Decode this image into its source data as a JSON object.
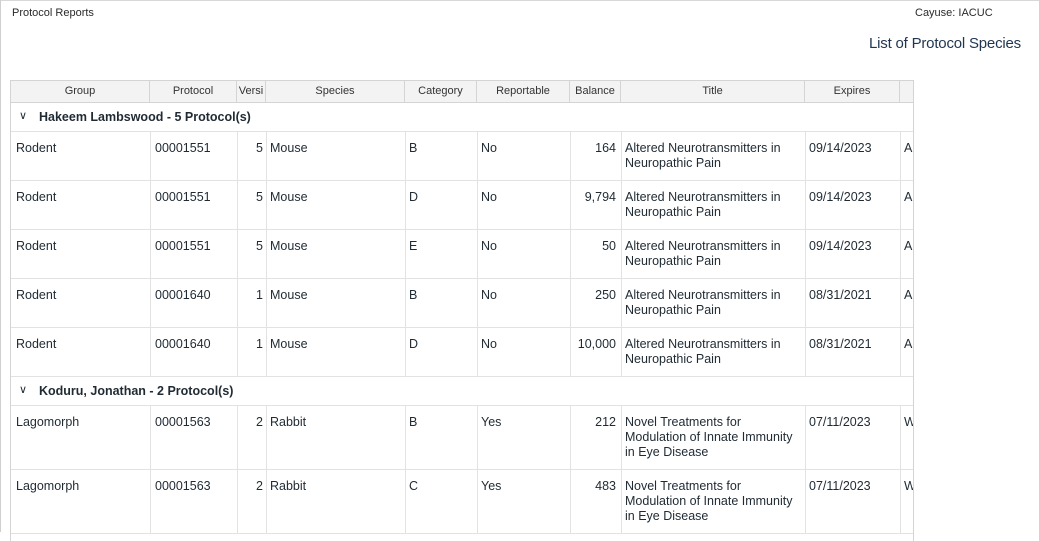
{
  "app_title": "Protocol Reports",
  "org_label": "Cayuse: IACUC",
  "page_title": "List of Protocol Species",
  "columns": {
    "group": "Group",
    "protocol": "Protocol",
    "version": "Versi",
    "species": "Species",
    "category": "Category",
    "reportable": "Reportable",
    "balance": "Balance",
    "title": "Title",
    "expires": "Expires"
  },
  "groups": [
    {
      "label": "Hakeem Lambswood - 5 Protocol(s)",
      "rows": [
        {
          "group": "Rodent",
          "protocol": "00001551",
          "version": "5",
          "species": "Mouse",
          "category": "B",
          "reportable": "No",
          "balance": "164",
          "title": "Altered Neurotransmitters in Neuropathic Pain",
          "expires": "09/14/2023",
          "extra": "A"
        },
        {
          "group": "Rodent",
          "protocol": "00001551",
          "version": "5",
          "species": "Mouse",
          "category": "D",
          "reportable": "No",
          "balance": "9,794",
          "title": "Altered Neurotransmitters in Neuropathic Pain",
          "expires": "09/14/2023",
          "extra": "A"
        },
        {
          "group": "Rodent",
          "protocol": "00001551",
          "version": "5",
          "species": "Mouse",
          "category": "E",
          "reportable": "No",
          "balance": "50",
          "title": "Altered Neurotransmitters in Neuropathic Pain",
          "expires": "09/14/2023",
          "extra": "A"
        },
        {
          "group": "Rodent",
          "protocol": "00001640",
          "version": "1",
          "species": "Mouse",
          "category": "B",
          "reportable": "No",
          "balance": "250",
          "title": "Altered Neurotransmitters in Neuropathic Pain",
          "expires": "08/31/2021",
          "extra": "A"
        },
        {
          "group": "Rodent",
          "protocol": "00001640",
          "version": "1",
          "species": "Mouse",
          "category": "D",
          "reportable": "No",
          "balance": "10,000",
          "title": "Altered Neurotransmitters in Neuropathic Pain",
          "expires": "08/31/2021",
          "extra": "A"
        }
      ]
    },
    {
      "label": "Koduru, Jonathan - 2 Protocol(s)",
      "rows": [
        {
          "group": "Lagomorph",
          "protocol": "00001563",
          "version": "2",
          "species": "Rabbit",
          "category": "B",
          "reportable": "Yes",
          "balance": "212",
          "title": "Novel Treatments for Modulation of Innate Immunity in Eye Disease",
          "expires": "07/11/2023",
          "extra": "W"
        },
        {
          "group": "Lagomorph",
          "protocol": "00001563",
          "version": "2",
          "species": "Rabbit",
          "category": "C",
          "reportable": "Yes",
          "balance": "483",
          "title": "Novel Treatments for Modulation of Innate Immunity in Eye Disease",
          "expires": "07/11/2023",
          "extra": "W"
        }
      ]
    }
  ]
}
